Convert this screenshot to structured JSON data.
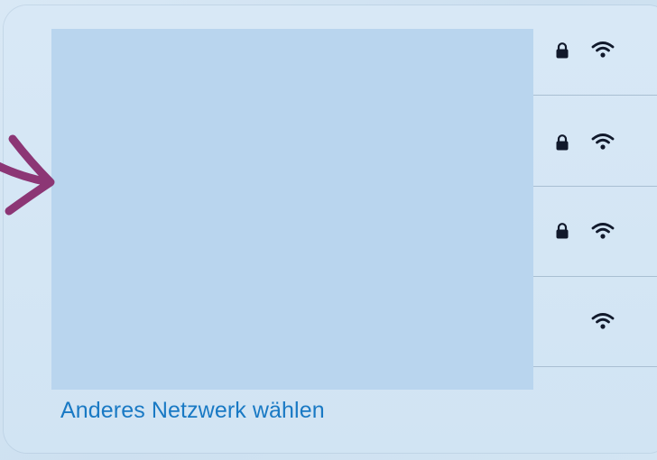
{
  "wifi_panel": {
    "networks": [
      {
        "secured": true,
        "lock_icon": "lock-icon",
        "signal_icon": "wifi-icon"
      },
      {
        "secured": true,
        "lock_icon": "lock-icon",
        "signal_icon": "wifi-icon"
      },
      {
        "secured": true,
        "lock_icon": "lock-icon",
        "signal_icon": "wifi-icon"
      },
      {
        "secured": false,
        "signal_icon": "wifi-icon"
      }
    ],
    "other_network_label": "Anderes Netzwerk wählen"
  },
  "colors": {
    "accent": "#1979c4",
    "panel_background": "#d3e5f3",
    "redaction": "#b9d5ee",
    "separator": "#a9bfd2",
    "icon": "#11192b",
    "annotation_arrow": "#8c3675"
  }
}
